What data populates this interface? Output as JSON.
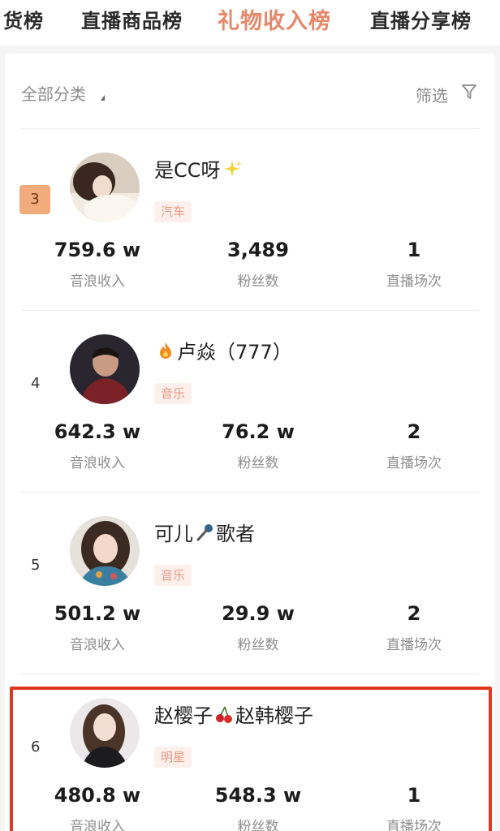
{
  "tabs": [
    {
      "label": "货榜"
    },
    {
      "label": "直播商品榜"
    },
    {
      "label": "礼物收入榜"
    },
    {
      "label": "直播分享榜"
    }
  ],
  "filter": {
    "category_label": "全部分类",
    "screen_label": "筛选"
  },
  "rows": [
    {
      "rank": "3",
      "name": "是CC呀",
      "tag": "汽车",
      "income": "759.6 w",
      "income_label": "音浪收入",
      "fans": "3,489",
      "fans_label": "粉丝数",
      "sessions": "1",
      "sessions_label": "直播场次"
    },
    {
      "rank": "4",
      "name_part1": "卢焱（777）",
      "tag": "音乐",
      "income": "642.3 w",
      "income_label": "音浪收入",
      "fans": "76.2 w",
      "fans_label": "粉丝数",
      "sessions": "2",
      "sessions_label": "直播场次"
    },
    {
      "rank": "5",
      "name_part1": "可儿",
      "name_part2": "歌者",
      "tag": "音乐",
      "income": "501.2 w",
      "income_label": "音浪收入",
      "fans": "29.9 w",
      "fans_label": "粉丝数",
      "sessions": "2",
      "sessions_label": "直播场次"
    },
    {
      "rank": "6",
      "name_part1": "赵樱子",
      "name_part2": "赵韩樱子",
      "tag": "明星",
      "income": "480.8 w",
      "income_label": "音浪收入",
      "fans": "548.3 w",
      "fans_label": "粉丝数",
      "sessions": "1",
      "sessions_label": "直播场次"
    }
  ],
  "colors": {
    "active_tab": "#e8886a",
    "rank_badge": "#f2ab7c",
    "tag_bg": "#fdf0ec",
    "tag_text": "#e99882",
    "highlight_border": "#e2381e"
  }
}
